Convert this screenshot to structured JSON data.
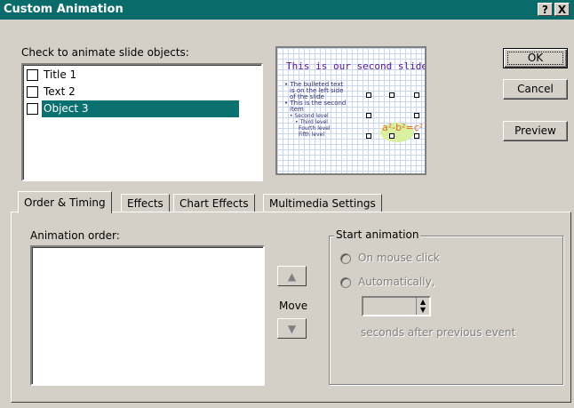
{
  "window": {
    "title": "Custom Animation"
  },
  "title_buttons": {
    "help": "?",
    "close": "X"
  },
  "objects": {
    "label": "Check to animate slide objects:",
    "items": [
      {
        "label": "Title 1",
        "checked": false,
        "selected": false
      },
      {
        "label": "Text 2",
        "checked": false,
        "selected": false
      },
      {
        "label": "Object 3",
        "checked": false,
        "selected": true
      }
    ]
  },
  "preview": {
    "slide_title": "This is our second slide",
    "body_lines": [
      "• The bulleted text",
      "  is on the left side",
      "  of the slide",
      "• This is the second",
      "  item",
      "  • Second level",
      "    • Third level",
      "      Fourth level",
      "      Fifth level"
    ],
    "equation": "a²-b²=c²"
  },
  "buttons": {
    "ok": "OK",
    "cancel": "Cancel",
    "preview": "Preview"
  },
  "tabs": [
    {
      "label": "Order & Timing",
      "active": true
    },
    {
      "label": "Effects",
      "active": false
    },
    {
      "label": "Chart Effects",
      "active": false
    },
    {
      "label": "Multimedia Settings",
      "active": false
    }
  ],
  "order_timing": {
    "animation_order_label": "Animation order:",
    "move_label": "Move",
    "start_group_label": "Start animation",
    "on_mouse_click": "On mouse click",
    "automatically": "Automatically,",
    "seconds_value": "",
    "after_text": "seconds after previous event"
  }
}
